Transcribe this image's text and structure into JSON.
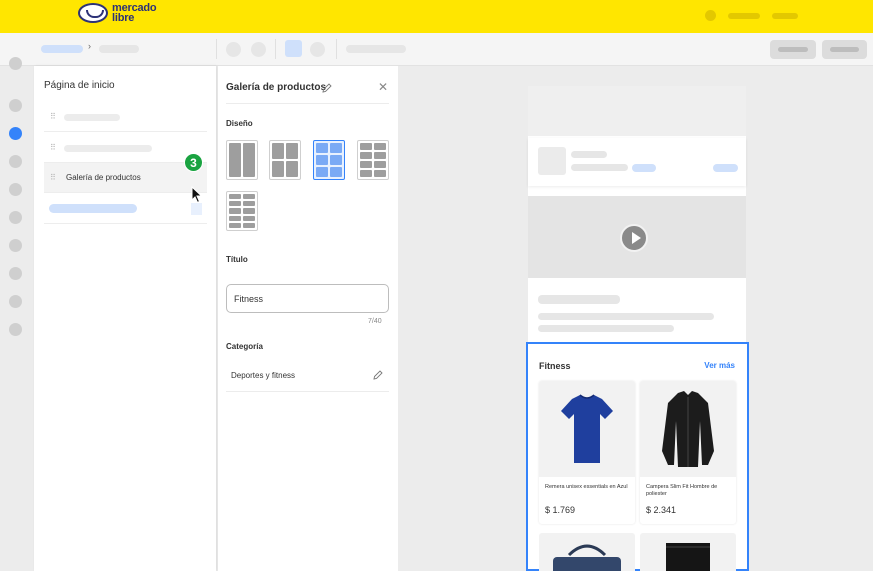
{
  "header": {
    "brand_line1": "mercado",
    "brand_line2": "libre"
  },
  "page_panel": {
    "title": "Página de inicio",
    "selected_item_label": "Galería de productos",
    "step_badge": "3"
  },
  "props_panel": {
    "title": "Galería de productos",
    "design_label": "Diseño",
    "layout_options": [
      "2 columnas",
      "2x2",
      "3x3",
      "3x4",
      "3x5"
    ],
    "selected_layout_index": 2,
    "title_label": "Título",
    "title_value": "Fitness",
    "title_counter": "7/40",
    "category_label": "Categoría",
    "category_value": "Deportes y fitness"
  },
  "preview": {
    "gallery_title": "Fitness",
    "gallery_more": "Ver más",
    "products": [
      {
        "name": "Remera unisex essentials en Azul",
        "price": "$ 1.769"
      },
      {
        "name": "Campera Slim Fit Hombre de poliester",
        "price": "$ 2.341"
      }
    ]
  },
  "colors": {
    "brand_yellow": "#ffe600",
    "accent_blue": "#3483fa",
    "badge_green": "#1aa341"
  }
}
